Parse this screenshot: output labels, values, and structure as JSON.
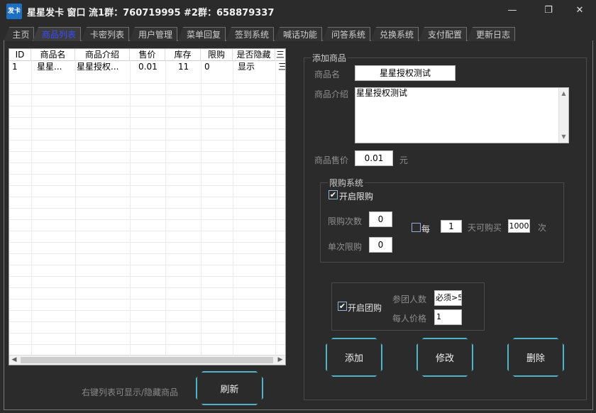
{
  "window": {
    "logo_text": "发卡",
    "title": "星星发卡 窗口 流1群：760719995 #2群：658879337",
    "minimize_icon": "minimize-icon",
    "maximize_icon": "restore-icon",
    "close_icon": "close-icon"
  },
  "tabs": [
    {
      "label": "主页",
      "active": false
    },
    {
      "label": "商品列表",
      "active": true
    },
    {
      "label": "卡密列表",
      "active": false
    },
    {
      "label": "用户管理",
      "active": false
    },
    {
      "label": "菜单回复",
      "active": false
    },
    {
      "label": "签到系统",
      "active": false
    },
    {
      "label": "喊话功能",
      "active": false
    },
    {
      "label": "问答系统",
      "active": false
    },
    {
      "label": "兑换系统",
      "active": false
    },
    {
      "label": "支付配置",
      "active": false
    },
    {
      "label": "更新日志",
      "active": false
    }
  ],
  "product_list": {
    "columns": [
      "ID",
      "商品名",
      "商品介绍",
      "售价",
      "库存",
      "限购",
      "是否隐藏",
      "三"
    ],
    "rows": [
      [
        "1",
        "星星...",
        "星星授权...",
        "0.01",
        "11",
        "0",
        "显示",
        "三"
      ]
    ],
    "scroll_left": "◀",
    "scroll_right": "▶"
  },
  "list_hint": "右键列表可显示/隐藏商品",
  "refresh_button": "刷新",
  "add_product": {
    "group_title": "添加商品",
    "name_label": "商品名",
    "name_value": "星星授权测试",
    "desc_label": "商品介绍",
    "desc_value": "星星授权测试",
    "price_label": "商品售价",
    "price_value": "0.01",
    "price_unit": "元"
  },
  "limit_system": {
    "group_title": "限购系统",
    "enable_label": "开启限购",
    "enable_checked": true,
    "limit_count_label": "限购次数",
    "limit_count_value": "0",
    "single_limit_label": "单次限购",
    "single_limit_value": "0",
    "every_label": "每",
    "every_checked": false,
    "every_days_value": "1",
    "days_can_buy_label": "天可购买",
    "times_value": "1000",
    "times_unit": "次"
  },
  "group_buy": {
    "enable_label": "开启团购",
    "enable_checked": true,
    "members_label": "参团人数",
    "members_value": "必须>5",
    "price_each_label": "每人价格",
    "price_each_value": "1"
  },
  "actions": {
    "add": "添加",
    "modify": "修改",
    "delete": "删除"
  }
}
